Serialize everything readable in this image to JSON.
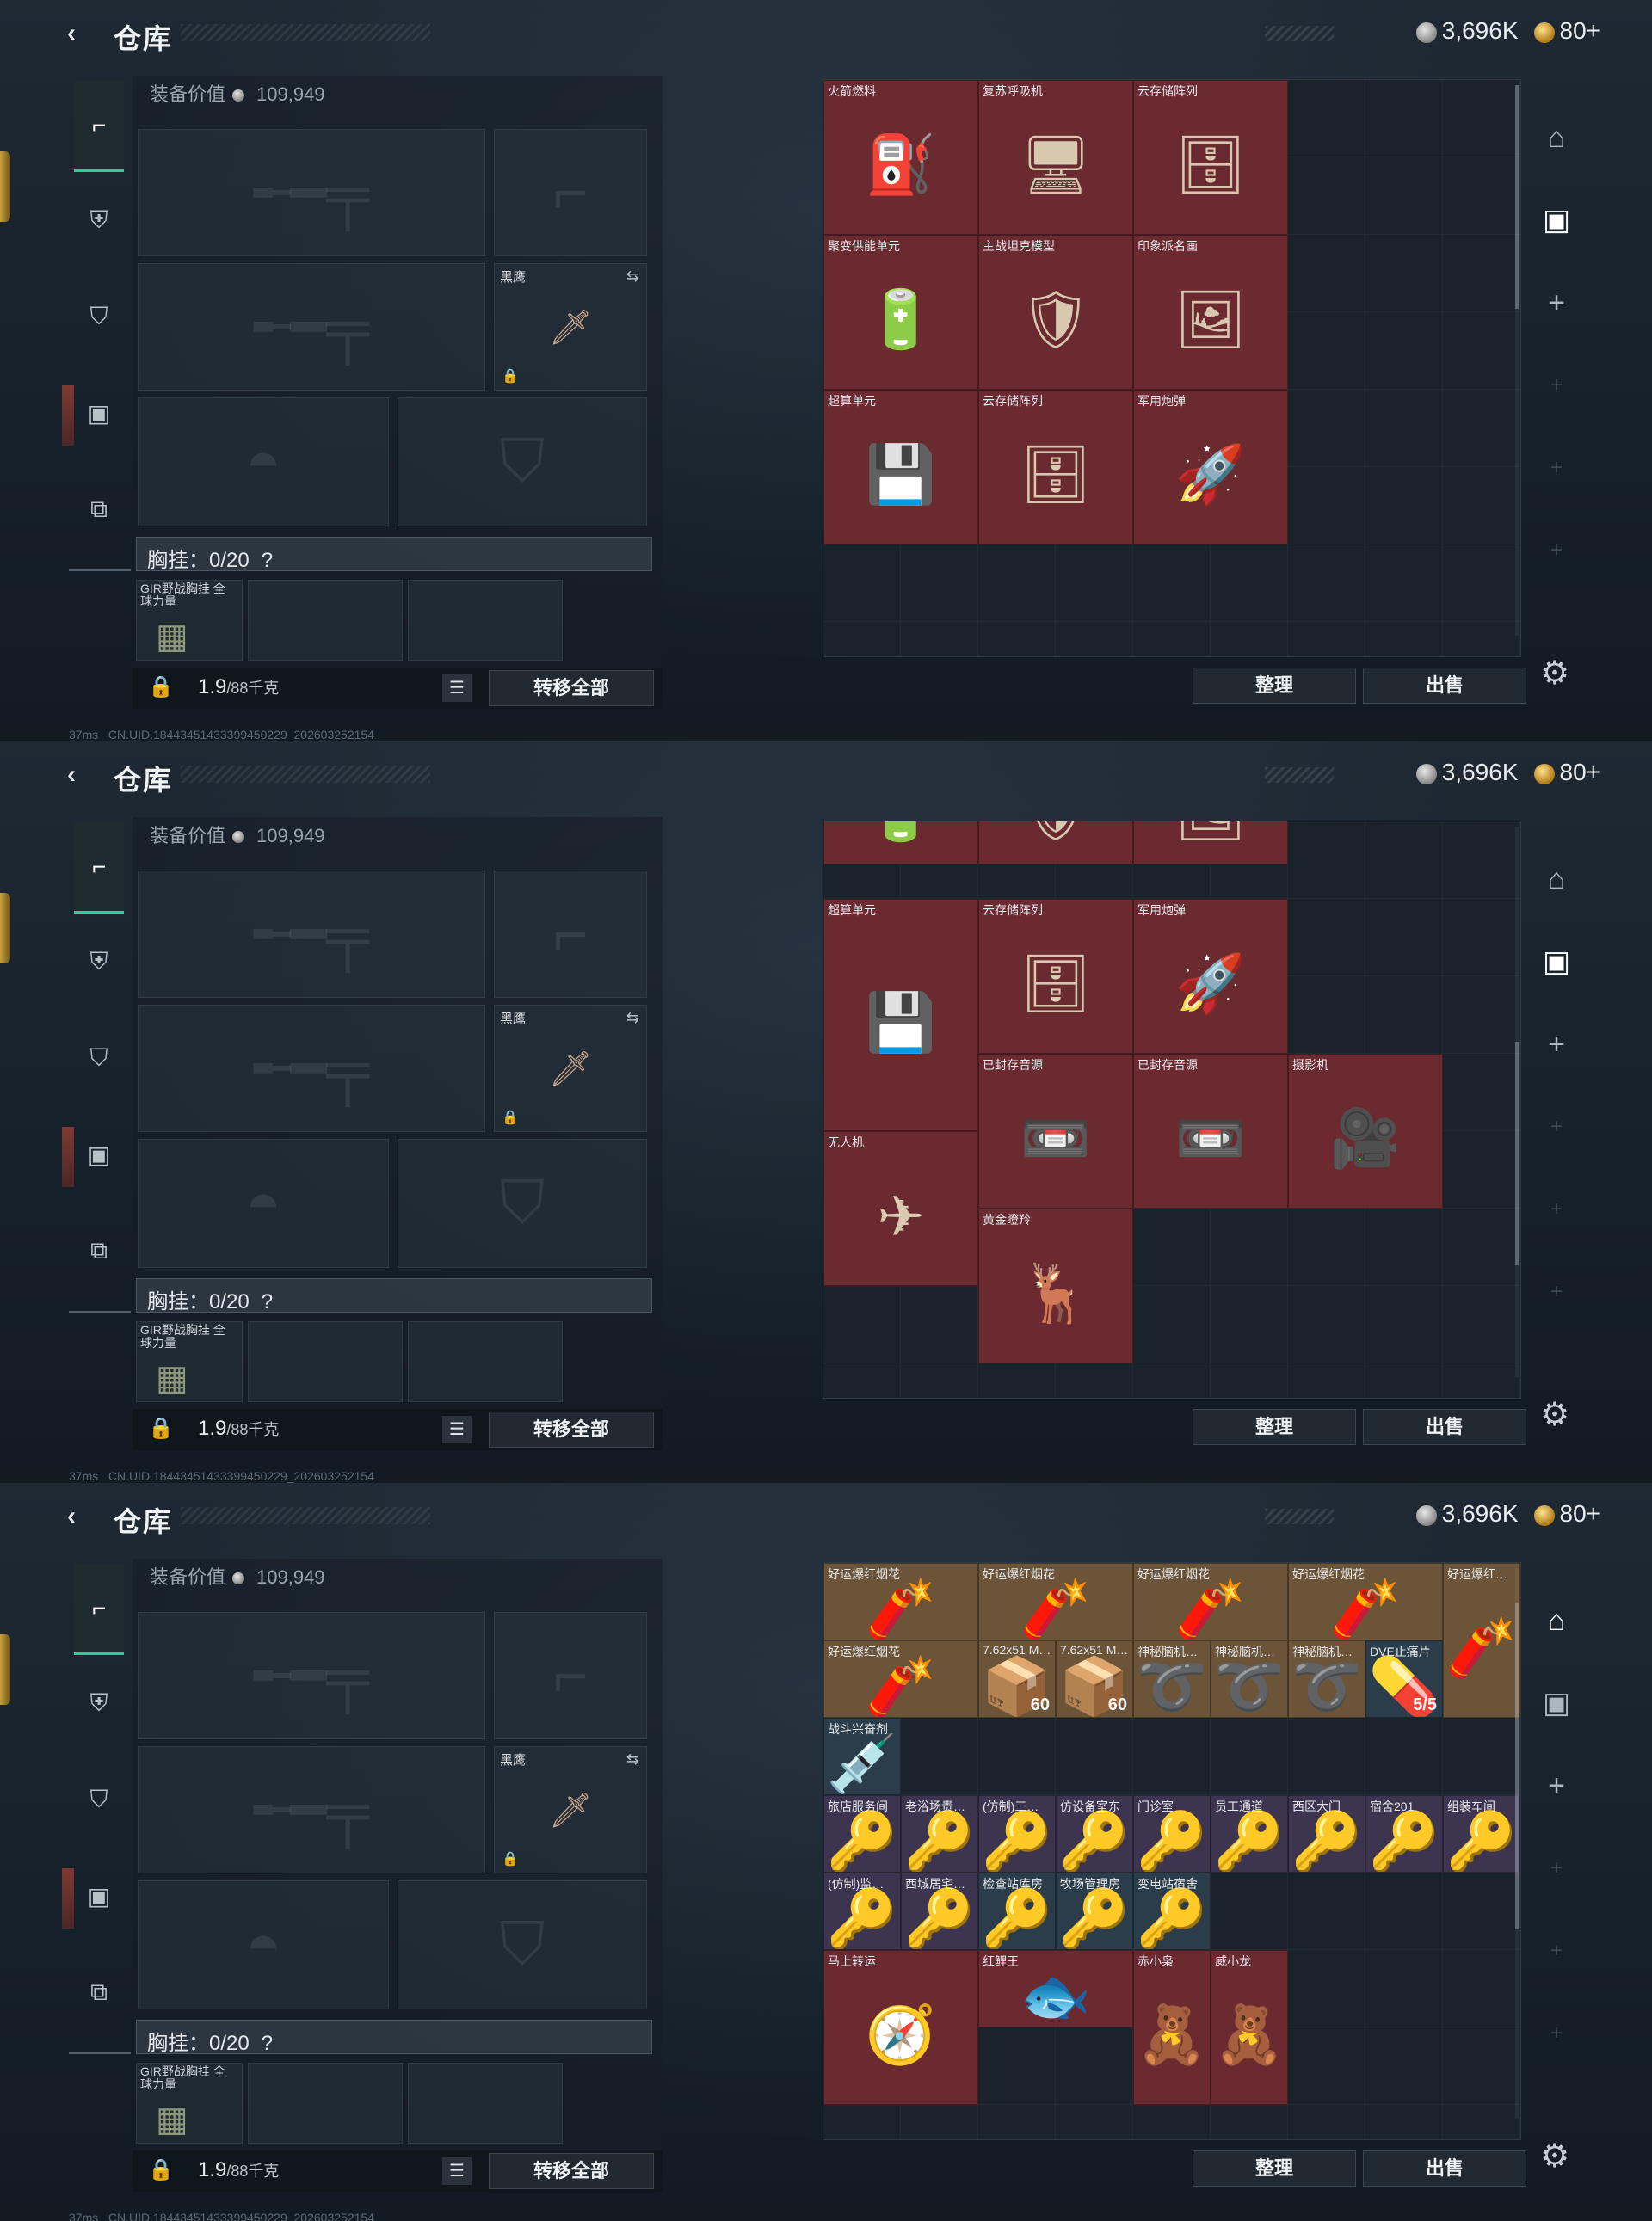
{
  "frames": [
    {
      "header": {
        "back_icon": "‹",
        "title": "仓库",
        "silver": "3,696K",
        "gold": "80+"
      },
      "sidebar": [
        {
          "icon": "pistol-icon"
        },
        {
          "icon": "vest-icon"
        },
        {
          "icon": "armor-icon"
        },
        {
          "icon": "backpack-icon"
        },
        {
          "icon": "toolbox-icon"
        }
      ],
      "left": {
        "equip_value_label": "装备价值",
        "equip_value": "109,949",
        "knife_name": "黑鹰",
        "vest_text": "胸挂：0/20",
        "vest_help": "?",
        "vest_item_name": "GIR野战胸挂\n全球力量",
        "weight_value": "1.9",
        "weight_unit": "/88千克",
        "transfer_all": "转移全部"
      },
      "right": {
        "tidy_label": "整理",
        "sell_label": "出售",
        "items": [
          {
            "name": "火箭燃料",
            "col": 0,
            "row": 0,
            "w": 2,
            "h": 2,
            "color": "red",
            "icon": "⛽"
          },
          {
            "name": "复苏呼吸机",
            "col": 2,
            "row": 0,
            "w": 2,
            "h": 2,
            "color": "red",
            "icon": "🖥"
          },
          {
            "name": "云存储阵列",
            "col": 4,
            "row": 0,
            "w": 2,
            "h": 2,
            "color": "red",
            "icon": "🗄"
          },
          {
            "name": "聚变供能单元",
            "col": 0,
            "row": 2,
            "w": 2,
            "h": 2,
            "color": "red",
            "icon": "🔋"
          },
          {
            "name": "主战坦克模型",
            "col": 2,
            "row": 2,
            "w": 2,
            "h": 2,
            "color": "red",
            "icon": "🛡"
          },
          {
            "name": "印象派名画",
            "col": 4,
            "row": 2,
            "w": 2,
            "h": 2,
            "color": "red",
            "icon": "🖼"
          },
          {
            "name": "超算单元",
            "col": 0,
            "row": 4,
            "w": 2,
            "h": 2,
            "color": "red",
            "icon": "💾"
          },
          {
            "name": "云存储阵列",
            "col": 2,
            "row": 4,
            "w": 2,
            "h": 2,
            "color": "red",
            "icon": "🗄"
          },
          {
            "name": "军用炮弹",
            "col": 4,
            "row": 4,
            "w": 2,
            "h": 2,
            "color": "red",
            "icon": "🚀"
          }
        ]
      },
      "footer": {
        "ping": "37ms",
        "uid": "CN.UID.18443451433399450229_202603252154"
      }
    },
    {
      "header": {
        "back_icon": "‹",
        "title": "仓库",
        "silver": "3,696K",
        "gold": "80+"
      },
      "sidebar": [
        {
          "icon": "pistol-icon"
        },
        {
          "icon": "vest-icon"
        },
        {
          "icon": "armor-icon"
        },
        {
          "icon": "backpack-icon"
        },
        {
          "icon": "toolbox-icon"
        }
      ],
      "left": {
        "equip_value_label": "装备价值",
        "equip_value": "109,949",
        "knife_name": "黑鹰",
        "vest_text": "胸挂：0/20",
        "vest_help": "?",
        "vest_item_name": "GIR野战胸挂\n全球力量",
        "weight_value": "1.9",
        "weight_unit": "/88千克",
        "transfer_all": "转移全部"
      },
      "right": {
        "tidy_label": "整理",
        "sell_label": "出售",
        "items": [
          {
            "name": "",
            "col": 0,
            "row": -1,
            "w": 2,
            "h": 1.55,
            "color": "red",
            "icon": "🔋"
          },
          {
            "name": "",
            "col": 2,
            "row": -1,
            "w": 2,
            "h": 1.55,
            "color": "red",
            "icon": "🛡"
          },
          {
            "name": "",
            "col": 4,
            "row": -1,
            "w": 2,
            "h": 1.55,
            "color": "red",
            "icon": "🖼"
          },
          {
            "name": "超算单元",
            "col": 0,
            "row": 1,
            "w": 2,
            "h": 3,
            "color": "red",
            "icon": "💾"
          },
          {
            "name": "云存储阵列",
            "col": 2,
            "row": 1,
            "w": 2,
            "h": 2,
            "color": "red",
            "icon": "🗄"
          },
          {
            "name": "军用炮弹",
            "col": 4,
            "row": 1,
            "w": 2,
            "h": 2,
            "color": "red",
            "icon": "🚀"
          },
          {
            "name": "已封存音源",
            "col": 2,
            "row": 3,
            "w": 2,
            "h": 2,
            "color": "red",
            "icon": "📼"
          },
          {
            "name": "已封存音源",
            "col": 4,
            "row": 3,
            "w": 2,
            "h": 2,
            "color": "red",
            "icon": "📼"
          },
          {
            "name": "摄影机",
            "col": 6,
            "row": 3,
            "w": 2,
            "h": 2,
            "color": "red",
            "icon": "🎥"
          },
          {
            "name": "无人机",
            "col": 0,
            "row": 4,
            "w": 2,
            "h": 2,
            "color": "red",
            "icon": "✈"
          },
          {
            "name": "黄金瞪羚",
            "col": 2,
            "row": 5,
            "w": 2,
            "h": 2,
            "color": "red",
            "icon": "🦌"
          }
        ]
      },
      "footer": {
        "ping": "37ms",
        "uid": "CN.UID.18443451433399450229_202603252154"
      }
    },
    {
      "header": {
        "back_icon": "‹",
        "title": "仓库",
        "silver": "3,696K",
        "gold": "80+"
      },
      "sidebar": [
        {
          "icon": "pistol-icon"
        },
        {
          "icon": "vest-icon"
        },
        {
          "icon": "armor-icon"
        },
        {
          "icon": "backpack-icon"
        },
        {
          "icon": "toolbox-icon"
        }
      ],
      "left": {
        "equip_value_label": "装备价值",
        "equip_value": "109,949",
        "knife_name": "黑鹰",
        "vest_text": "胸挂：0/20",
        "vest_help": "?",
        "vest_item_name": "GIR野战胸挂\n全球力量",
        "weight_value": "1.9",
        "weight_unit": "/88千克",
        "transfer_all": "转移全部"
      },
      "right": {
        "tidy_label": "整理",
        "sell_label": "出售",
        "items": [
          {
            "name": "好运爆红烟花",
            "col": 0,
            "row": 0,
            "w": 2,
            "h": 1,
            "color": "gold",
            "icon": "🧨"
          },
          {
            "name": "好运爆红烟花",
            "col": 2,
            "row": 0,
            "w": 2,
            "h": 1,
            "color": "gold",
            "icon": "🧨"
          },
          {
            "name": "好运爆红烟花",
            "col": 4,
            "row": 0,
            "w": 2,
            "h": 1,
            "color": "gold",
            "icon": "🧨"
          },
          {
            "name": "好运爆红烟花",
            "col": 6,
            "row": 0,
            "w": 2,
            "h": 1,
            "color": "gold",
            "icon": "🧨"
          },
          {
            "name": "好运爆红…",
            "col": 8,
            "row": 0,
            "w": 1,
            "h": 2,
            "color": "gold",
            "icon": "🧨"
          },
          {
            "name": "好运爆红烟花",
            "col": 0,
            "row": 1,
            "w": 2,
            "h": 1,
            "color": "gold",
            "icon": "🧨"
          },
          {
            "name": "7.62x51 M…",
            "col": 2,
            "row": 1,
            "w": 1,
            "h": 1,
            "color": "gold",
            "icon": "📦",
            "count": "60"
          },
          {
            "name": "7.62x51 M…",
            "col": 3,
            "row": 1,
            "w": 1,
            "h": 1,
            "color": "gold",
            "icon": "📦",
            "count": "60"
          },
          {
            "name": "神秘脑机…",
            "col": 4,
            "row": 1,
            "w": 1,
            "h": 1,
            "color": "gold",
            "icon": "➰"
          },
          {
            "name": "神秘脑机…",
            "col": 5,
            "row": 1,
            "w": 1,
            "h": 1,
            "color": "gold",
            "icon": "➰"
          },
          {
            "name": "神秘脑机…",
            "col": 6,
            "row": 1,
            "w": 1,
            "h": 1,
            "color": "gold",
            "icon": "➰"
          },
          {
            "name": "DVE止痛片",
            "col": 7,
            "row": 1,
            "w": 1,
            "h": 1,
            "color": "blue",
            "icon": "💊",
            "count": "5/5"
          },
          {
            "name": "战斗兴奋剂",
            "col": 0,
            "row": 2,
            "w": 1,
            "h": 1,
            "color": "blue",
            "icon": "💉"
          },
          {
            "name": "旅店服务间",
            "col": 0,
            "row": 3,
            "w": 1,
            "h": 1,
            "color": "purp",
            "icon": "🔑"
          },
          {
            "name": "老浴场贵…",
            "col": 1,
            "row": 3,
            "w": 1,
            "h": 1,
            "color": "purp",
            "icon": "🔑"
          },
          {
            "name": "(仿制)三…",
            "col": 2,
            "row": 3,
            "w": 1,
            "h": 1,
            "color": "purp",
            "icon": "🔑"
          },
          {
            "name": "仿设备室东",
            "col": 3,
            "row": 3,
            "w": 1,
            "h": 1,
            "color": "purp",
            "icon": "🔑"
          },
          {
            "name": "门诊室",
            "col": 4,
            "row": 3,
            "w": 1,
            "h": 1,
            "color": "purp",
            "icon": "🔑"
          },
          {
            "name": "员工通道",
            "col": 5,
            "row": 3,
            "w": 1,
            "h": 1,
            "color": "purp",
            "icon": "🔑"
          },
          {
            "name": "西区大门",
            "col": 6,
            "row": 3,
            "w": 1,
            "h": 1,
            "color": "purp",
            "icon": "🔑"
          },
          {
            "name": "宿舍201",
            "col": 7,
            "row": 3,
            "w": 1,
            "h": 1,
            "color": "purp",
            "icon": "🔑"
          },
          {
            "name": "组装车间",
            "col": 8,
            "row": 3,
            "w": 1,
            "h": 1,
            "color": "purp",
            "icon": "🔑"
          },
          {
            "name": "(仿制)监…",
            "col": 0,
            "row": 4,
            "w": 1,
            "h": 1,
            "color": "purp",
            "icon": "🔑"
          },
          {
            "name": "西城居宅…",
            "col": 1,
            "row": 4,
            "w": 1,
            "h": 1,
            "color": "purp",
            "icon": "🔑"
          },
          {
            "name": "检查站库房",
            "col": 2,
            "row": 4,
            "w": 1,
            "h": 1,
            "color": "blue",
            "icon": "🔑"
          },
          {
            "name": "牧场管理房",
            "col": 3,
            "row": 4,
            "w": 1,
            "h": 1,
            "color": "blue",
            "icon": "🔑"
          },
          {
            "name": "变电站宿舍",
            "col": 4,
            "row": 4,
            "w": 1,
            "h": 1,
            "color": "blue",
            "icon": "🔑"
          },
          {
            "name": "马上转运",
            "col": 0,
            "row": 5,
            "w": 2,
            "h": 2,
            "color": "red",
            "icon": "🧭"
          },
          {
            "name": "红鲤王",
            "col": 2,
            "row": 5,
            "w": 2,
            "h": 1,
            "color": "red",
            "icon": "🐟"
          },
          {
            "name": "赤小枭",
            "col": 4,
            "row": 5,
            "w": 1,
            "h": 2,
            "color": "red",
            "icon": "🧸"
          },
          {
            "name": "威小龙",
            "col": 5,
            "row": 5,
            "w": 1,
            "h": 2,
            "color": "red",
            "icon": "🧸"
          }
        ]
      },
      "footer": {
        "ping": "37ms",
        "uid": "CN.UID.18443451433399450229_202603252154"
      }
    }
  ]
}
